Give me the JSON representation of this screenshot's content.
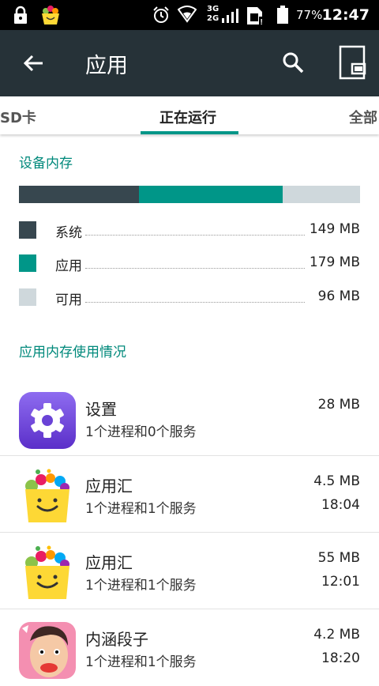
{
  "status_bar": {
    "network_3g": "3G",
    "network_2g": "2G",
    "battery": "77%",
    "time": "12:47"
  },
  "toolbar": {
    "title": "应用"
  },
  "tabs": {
    "left": "SD卡",
    "center": "正在运行",
    "right": "全部"
  },
  "device_memory": {
    "title": "设备内存",
    "segments": [
      {
        "label": "系统",
        "value": "149 MB",
        "color": "#37474f",
        "mb": 149
      },
      {
        "label": "应用",
        "value": "179 MB",
        "color": "#009688",
        "mb": 179
      },
      {
        "label": "可用",
        "value": "96 MB",
        "color": "#cfd8dc",
        "mb": 96
      }
    ]
  },
  "app_memory": {
    "title": "应用内存使用情况",
    "apps": [
      {
        "name": "设置",
        "subtitle": "1个进程和0个服务",
        "size": "28 MB",
        "time": "",
        "icon": "settings-icon"
      },
      {
        "name": "应用汇",
        "subtitle": "1个进程和1个服务",
        "size": "4.5 MB",
        "time": "18:04",
        "icon": "appchina-icon"
      },
      {
        "name": "应用汇",
        "subtitle": "1个进程和1个服务",
        "size": "55 MB",
        "time": "12:01",
        "icon": "appchina-icon"
      },
      {
        "name": "内涵段子",
        "subtitle": "1个进程和1个服务",
        "size": "4.2 MB",
        "time": "18:20",
        "icon": "neihan-icon"
      }
    ]
  }
}
